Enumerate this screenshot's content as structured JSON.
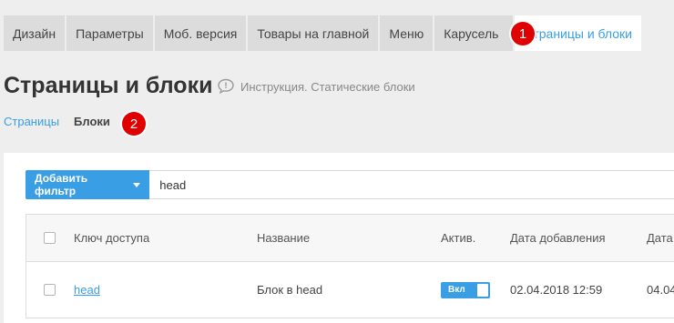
{
  "tabs": [
    {
      "label": "Дизайн"
    },
    {
      "label": "Параметры"
    },
    {
      "label": "Моб. версия"
    },
    {
      "label": "Товары на главной"
    },
    {
      "label": "Меню"
    },
    {
      "label": "Карусель"
    },
    {
      "label": "Страницы и блоки",
      "active": true
    }
  ],
  "markers": {
    "one": "1",
    "two": "2"
  },
  "page_title": "Страницы и блоки",
  "instruction": {
    "icon": "speech-bubble-icon",
    "text": "Инструкция. Статические блоки"
  },
  "subnav": {
    "pages": "Страницы",
    "blocks": "Блоки"
  },
  "filter": {
    "button_label": "Добавить фильтр",
    "value": "head"
  },
  "table": {
    "headers": {
      "key": "Ключ доступа",
      "name": "Название",
      "active": "Актив.",
      "date_added": "Дата добавления",
      "date_changed": "Дата"
    },
    "rows": [
      {
        "key": "head",
        "name": "Блок в head",
        "toggle": "Вкл",
        "date_added": "02.04.2018 12:59",
        "date_changed": "04.04"
      }
    ]
  },
  "colors": {
    "accent": "#3a9ee4",
    "marker": "#e00000"
  }
}
